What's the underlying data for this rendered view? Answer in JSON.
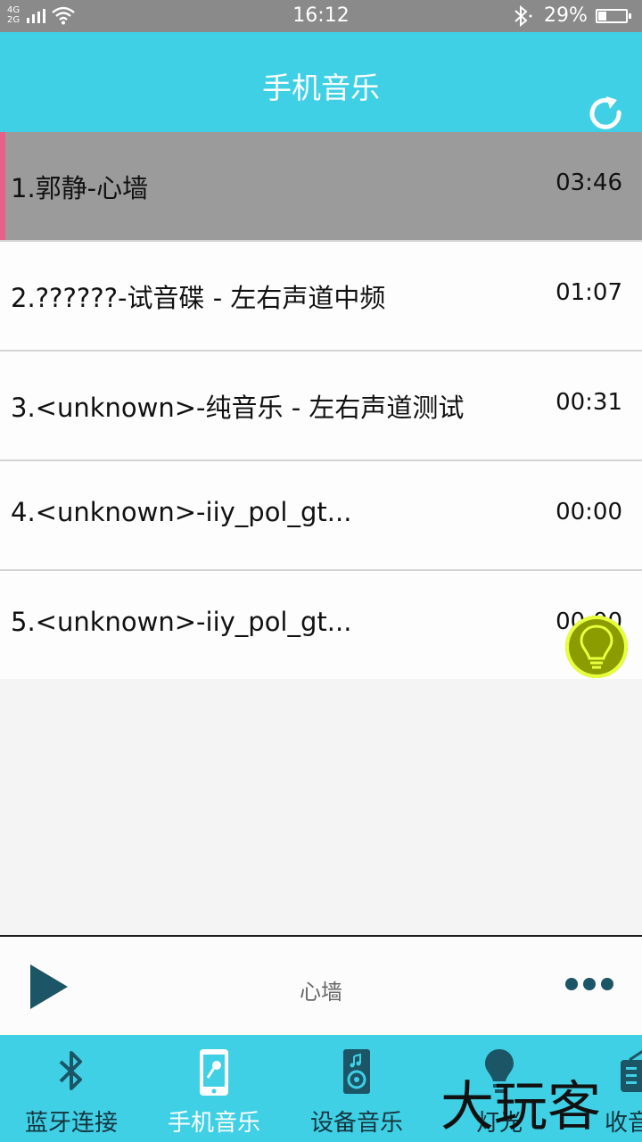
{
  "status_bar": {
    "network_top": "4G",
    "network_bottom": "2G",
    "time": "16:12",
    "battery": "29%",
    "battery_level": 0.29
  },
  "header": {
    "title": "手机音乐"
  },
  "songs": [
    {
      "name": "1.郭静-心墙",
      "duration": "03:46"
    },
    {
      "name": "2.??????-试音碟 - 左右声道中频",
      "duration": "01:07"
    },
    {
      "name": "3.<unknown>-纯音乐 - 左右声道测试",
      "duration": "00:31"
    },
    {
      "name": "4.<unknown>-iiy_pol_gt...",
      "duration": "00:00"
    },
    {
      "name": "5.<unknown>-iiy_pol_gt...",
      "duration": "00:00"
    }
  ],
  "player": {
    "now_playing": "心墙"
  },
  "tabs": [
    {
      "label": "蓝牙连接",
      "icon": "bluetooth-icon"
    },
    {
      "label": "手机音乐",
      "icon": "phone-music-icon"
    },
    {
      "label": "设备音乐",
      "icon": "speaker-icon"
    },
    {
      "label": "灯光",
      "icon": "bulb-icon"
    },
    {
      "label": "收音",
      "icon": "radio-icon"
    }
  ],
  "watermark": "大玩客",
  "colors": {
    "accent": "#3fd0e6",
    "active_row": "#9b9b9b",
    "active_marker": "#e8608a",
    "dark_icon": "#1c5566"
  }
}
